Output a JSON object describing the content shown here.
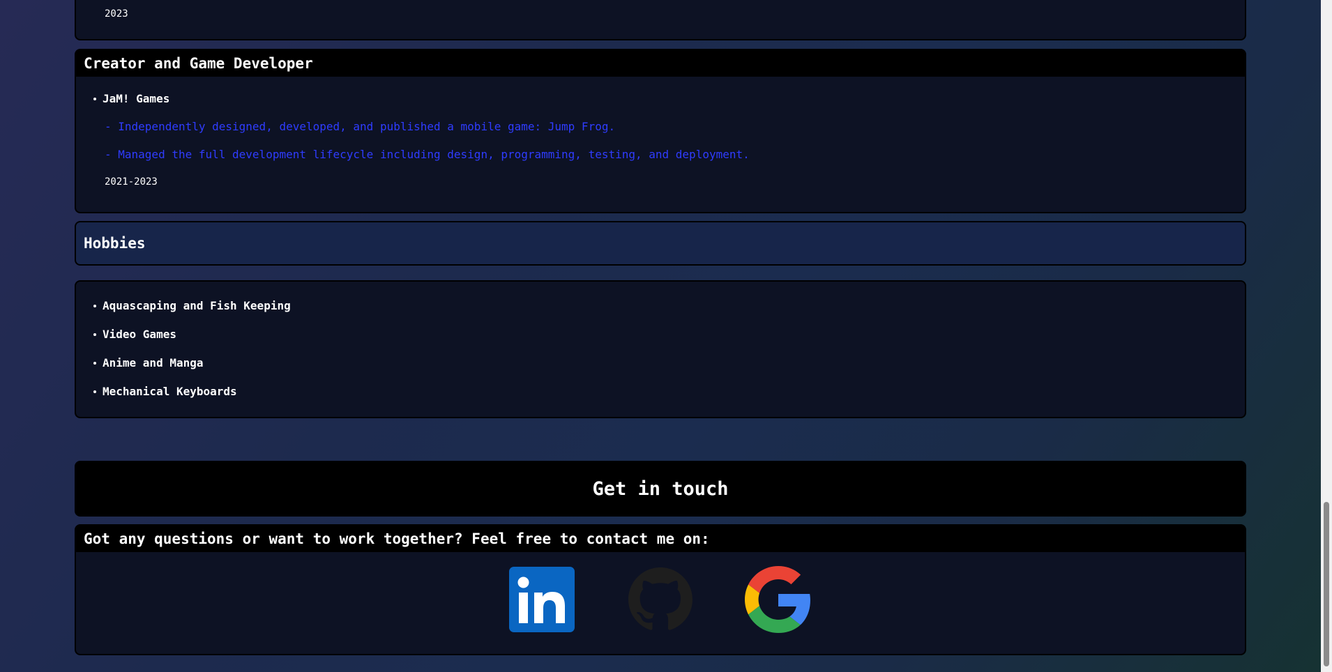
{
  "previous_entry": {
    "date": "2023"
  },
  "experience_card": {
    "title": "Creator and Game Developer",
    "company": "JaM! Games",
    "details": [
      "- Independently designed, developed, and published a mobile game: Jump Frog.",
      "- Managed the full development lifecycle including design, programming, testing, and deployment."
    ],
    "date": "2021-2023"
  },
  "hobbies": {
    "title": "Hobbies",
    "items": [
      "Aquascaping and Fish Keeping",
      "Video Games",
      "Anime and Manga",
      "Mechanical Keyboards"
    ]
  },
  "contact": {
    "heading": "Get in touch",
    "prompt": "Got any questions or want to work together? Feel free to contact me on:",
    "links": [
      {
        "icon": "linkedin-icon",
        "label": "in"
      },
      {
        "icon": "github-icon"
      },
      {
        "icon": "google-icon"
      }
    ]
  },
  "colors": {
    "accent_text": "#2f3cff",
    "card_bg": "#0d1224",
    "header_bg": "#000000",
    "linkedin": "#0a66c2",
    "github": "#1e1e1e"
  }
}
